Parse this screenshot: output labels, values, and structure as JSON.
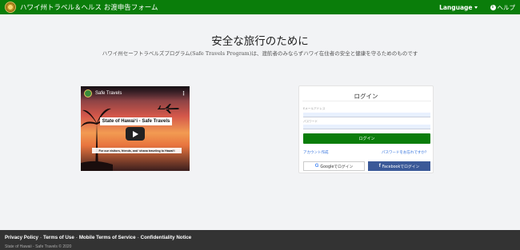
{
  "header": {
    "brand": "ハワイ州トラベル＆ヘルス お渡申告フォーム",
    "language_label": "Language",
    "help_label": "ヘルプ"
  },
  "hero": {
    "title": "安全な旅行のために",
    "subtitle": "ハワイ州セーフトラベルズプログラム(Safe Travels Program)は、渡航者のみならずハワイ在住者の安全と健康を守るためのものです"
  },
  "video": {
    "title": "Safe Travels",
    "banner": "State of Hawaiʻi - Safe Travels",
    "caption": "For our visitors, friends, and ʻohana traveling to Hawaiʻi"
  },
  "login": {
    "title": "ログイン",
    "email_label": "Eメールアドレス",
    "email_value": "",
    "password_label": "パスワード",
    "password_value": "",
    "login_button": "ログイン",
    "create_account": "アカウント作成",
    "forgot_password": "パスワードをお忘れですか？",
    "google_button": "Googleでログイン",
    "facebook_button": "Facebookでログイン"
  },
  "footer": {
    "links": [
      "Privacy Policy",
      "Terms of Use",
      "Mobile Terms of Service",
      "Confidentiality Notice"
    ],
    "copyright": "State of Hawaii - Safe Travels © 2020"
  },
  "colors": {
    "primary": "#0a7d0a",
    "facebook": "#3b5998",
    "footer": "#333333",
    "link": "#2f6fdc"
  }
}
